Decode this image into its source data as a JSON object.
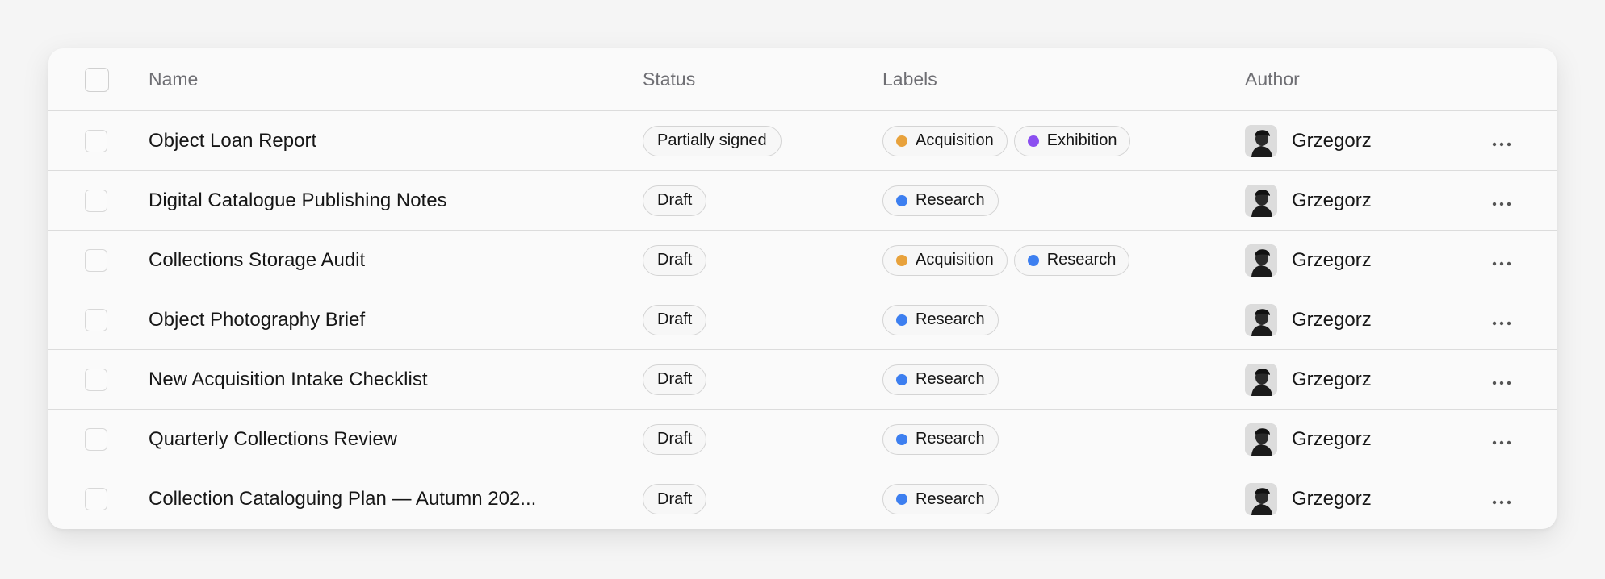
{
  "table": {
    "columns": {
      "name": "Name",
      "status": "Status",
      "labels": "Labels",
      "author": "Author"
    },
    "rows": [
      {
        "name": "Object Loan Report",
        "status": "Partially signed",
        "labels": [
          {
            "text": "Acquisition",
            "color": "#e8a23c"
          },
          {
            "text": "Exhibition",
            "color": "#8b4ff0"
          }
        ],
        "author": "Grzegorz"
      },
      {
        "name": "Digital Catalogue Publishing Notes",
        "status": "Draft",
        "labels": [
          {
            "text": "Research",
            "color": "#3d7ff0"
          }
        ],
        "author": "Grzegorz"
      },
      {
        "name": "Collections Storage Audit",
        "status": "Draft",
        "labels": [
          {
            "text": "Acquisition",
            "color": "#e8a23c"
          },
          {
            "text": "Research",
            "color": "#3d7ff0"
          }
        ],
        "author": "Grzegorz"
      },
      {
        "name": "Object Photography Brief",
        "status": "Draft",
        "labels": [
          {
            "text": "Research",
            "color": "#3d7ff0"
          }
        ],
        "author": "Grzegorz"
      },
      {
        "name": "New Acquisition Intake Checklist",
        "status": "Draft",
        "labels": [
          {
            "text": "Research",
            "color": "#3d7ff0"
          }
        ],
        "author": "Grzegorz"
      },
      {
        "name": "Quarterly Collections Review",
        "status": "Draft",
        "labels": [
          {
            "text": "Research",
            "color": "#3d7ff0"
          }
        ],
        "author": "Grzegorz"
      },
      {
        "name": "Collection Cataloguing Plan — Autumn 202...",
        "status": "Draft",
        "labels": [
          {
            "text": "Research",
            "color": "#3d7ff0"
          }
        ],
        "author": "Grzegorz"
      }
    ],
    "row_action_icon": "more-horizontal-icon",
    "avatar_icon": "user-avatar-icon"
  }
}
